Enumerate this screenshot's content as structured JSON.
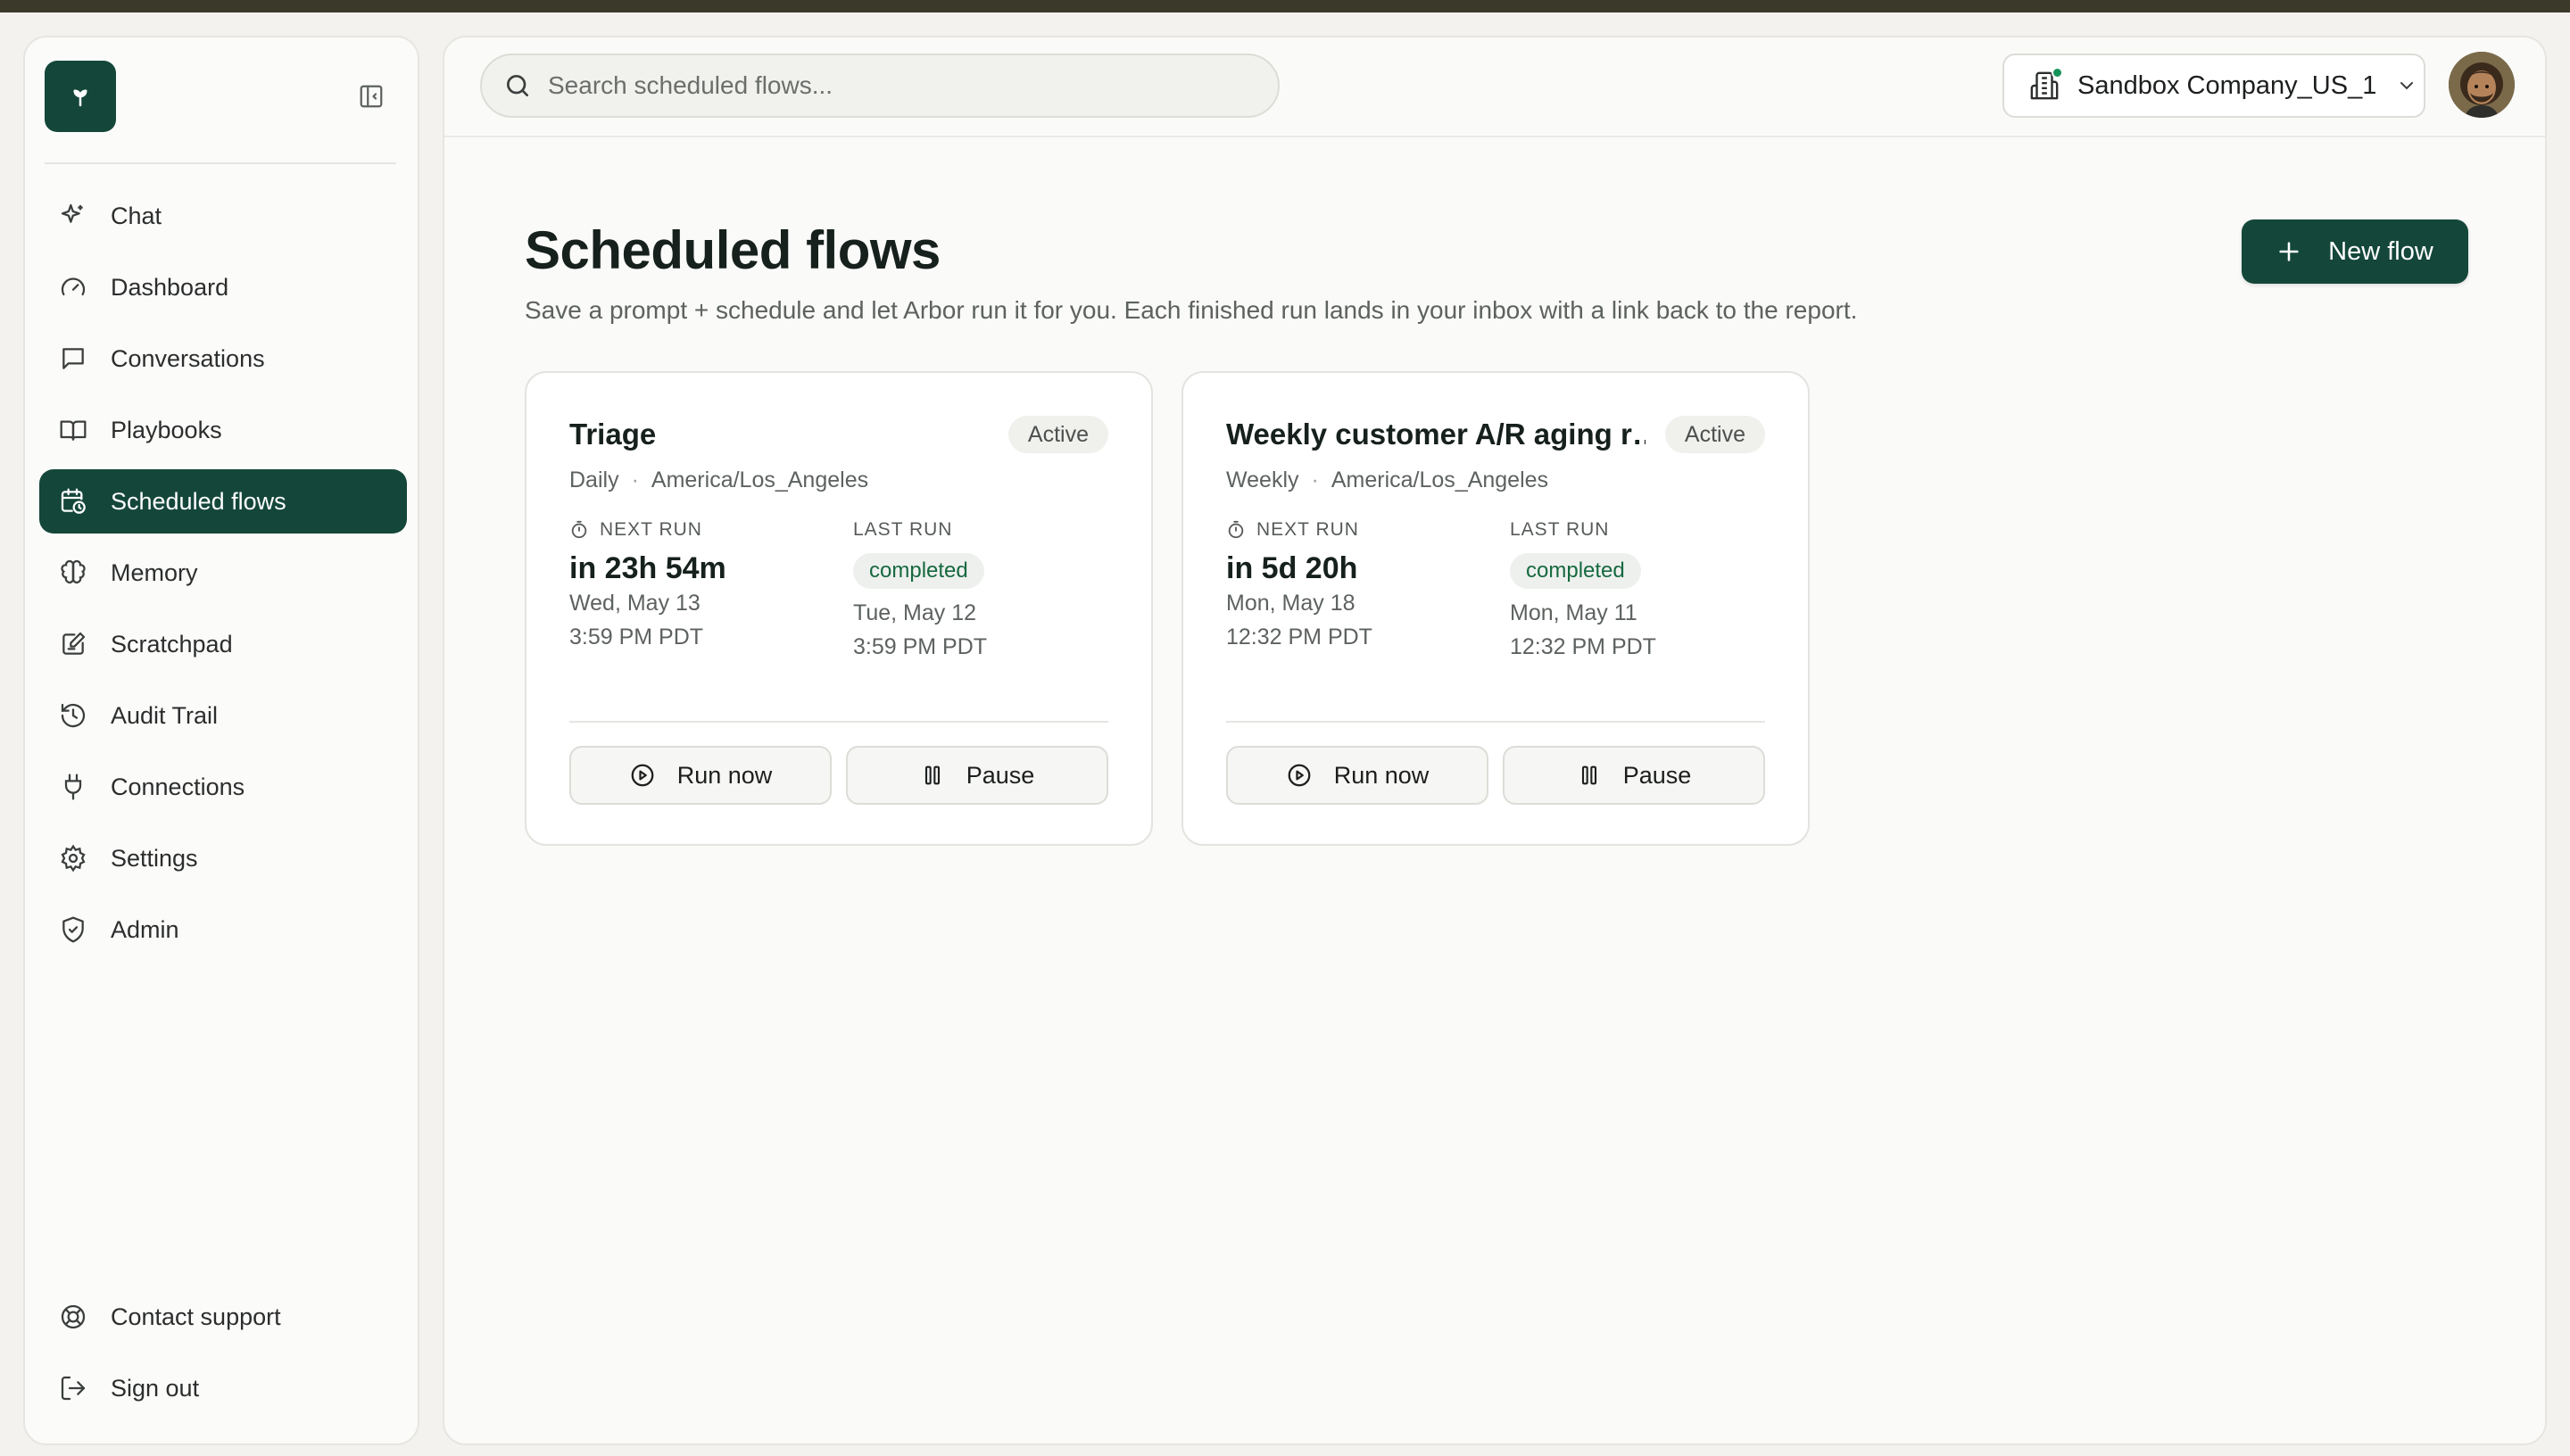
{
  "sidebar": {
    "items": [
      {
        "label": "Chat",
        "icon": "sparkle-icon"
      },
      {
        "label": "Dashboard",
        "icon": "gauge-icon"
      },
      {
        "label": "Conversations",
        "icon": "message-icon"
      },
      {
        "label": "Playbooks",
        "icon": "book-icon"
      },
      {
        "label": "Scheduled flows",
        "icon": "calendar-clock-icon",
        "active": true
      },
      {
        "label": "Memory",
        "icon": "brain-icon"
      },
      {
        "label": "Scratchpad",
        "icon": "notepad-icon"
      },
      {
        "label": "Audit Trail",
        "icon": "history-icon"
      },
      {
        "label": "Connections",
        "icon": "plug-icon"
      },
      {
        "label": "Settings",
        "icon": "gear-icon"
      },
      {
        "label": "Admin",
        "icon": "shield-icon"
      }
    ],
    "bottom": [
      {
        "label": "Contact support",
        "icon": "lifebuoy-icon"
      },
      {
        "label": "Sign out",
        "icon": "sign-out-icon"
      }
    ]
  },
  "search": {
    "placeholder": "Search scheduled flows..."
  },
  "company": {
    "name": "Sandbox Company_US_1"
  },
  "page": {
    "title": "Scheduled flows",
    "subtitle": "Save a prompt + schedule and let Arbor run it for you. Each finished run lands in your inbox with a link back to the report.",
    "new_flow_label": "New flow"
  },
  "flows": [
    {
      "title": "Triage",
      "status": "Active",
      "frequency": "Daily",
      "timezone": "America/Los_Angeles",
      "next_run_label": "NEXT RUN",
      "next_run_in": "in 23h 54m",
      "next_run_date": "Wed, May 13",
      "next_run_time": "3:59 PM PDT",
      "last_run_label": "LAST RUN",
      "last_run_status": "completed",
      "last_run_date": "Tue, May 12",
      "last_run_time": "3:59 PM PDT",
      "run_now_label": "Run now",
      "pause_label": "Pause"
    },
    {
      "title": "Weekly customer A/R aging r…",
      "status": "Active",
      "frequency": "Weekly",
      "timezone": "America/Los_Angeles",
      "next_run_label": "NEXT RUN",
      "next_run_in": "in 5d 20h",
      "next_run_date": "Mon, May 18",
      "next_run_time": "12:32 PM PDT",
      "last_run_label": "LAST RUN",
      "last_run_status": "completed",
      "last_run_date": "Mon, May 11",
      "last_run_time": "12:32 PM PDT",
      "run_now_label": "Run now",
      "pause_label": "Pause"
    }
  ],
  "colors": {
    "brand": "#14473a",
    "success": "#16693f",
    "accent_dot": "#15935a"
  }
}
